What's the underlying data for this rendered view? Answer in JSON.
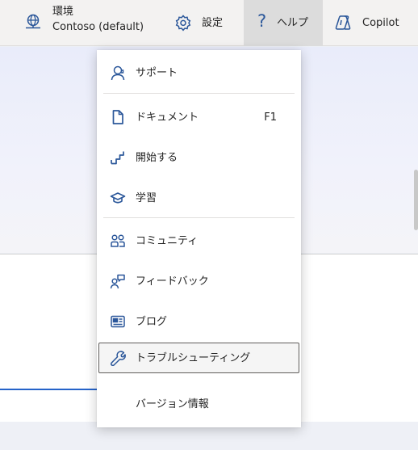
{
  "topbar": {
    "environment": {
      "label": "環境",
      "value": "Contoso (default)",
      "icon": "globe-icon"
    },
    "settings": {
      "label": "設定",
      "icon": "gear-icon"
    },
    "help": {
      "label": "ヘルプ",
      "icon": "question-icon"
    },
    "copilot": {
      "label": "Copilot",
      "icon": "copilot-icon"
    }
  },
  "help_menu": {
    "items": [
      {
        "label": "サポート",
        "icon": "person-support-icon"
      },
      {
        "label": "ドキュメント",
        "shortcut": "F1",
        "icon": "document-icon"
      },
      {
        "label": "開始する",
        "icon": "stairs-icon"
      },
      {
        "label": "学習",
        "icon": "graduation-cap-icon"
      },
      {
        "label": "コミュニティ",
        "icon": "people-community-icon"
      },
      {
        "label": "フィードバック",
        "icon": "person-feedback-icon"
      },
      {
        "label": "ブログ",
        "icon": "news-icon"
      },
      {
        "label": "トラブルシューティング",
        "icon": "wrench-icon",
        "focused": true
      },
      {
        "label": "バージョン情報"
      }
    ]
  },
  "colors": {
    "accent": "#2b579a",
    "help_active_bg": "#dcdcdc",
    "focus_border": "#605e5c"
  }
}
